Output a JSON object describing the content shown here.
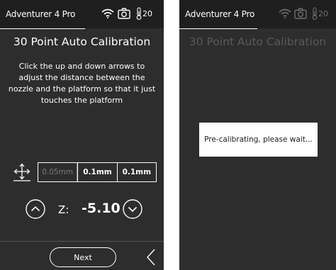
{
  "screen1": {
    "device_name": "Adventurer 4 Pro",
    "temperature": "20",
    "title": "30 Point Auto Calibration",
    "instruction": "Click the up and down arrows to adjust the distance between the nozzle and the platform so that it just touches the platform",
    "step_options": [
      "0.05mm",
      "0.1mm",
      "0.1mm"
    ],
    "z_label": "Z:",
    "z_value": "-5.10",
    "next_label": "Next"
  },
  "screen2": {
    "device_name": "Adventurer 4 Pro",
    "temperature": "20",
    "title": "30 Point Auto Calibration",
    "dialog_text": "Pre-calibrating, please wait..."
  },
  "icons": [
    "wifi-icon",
    "camera-icon",
    "thermometer-icon",
    "move-axes-icon",
    "arrow-up-icon",
    "arrow-down-icon",
    "back-icon"
  ],
  "colors": {
    "screen_bg": "#2d2d2d",
    "status_bg": "#1f1f1f",
    "text": "#ffffff",
    "dialog_bg": "#ffffff"
  }
}
